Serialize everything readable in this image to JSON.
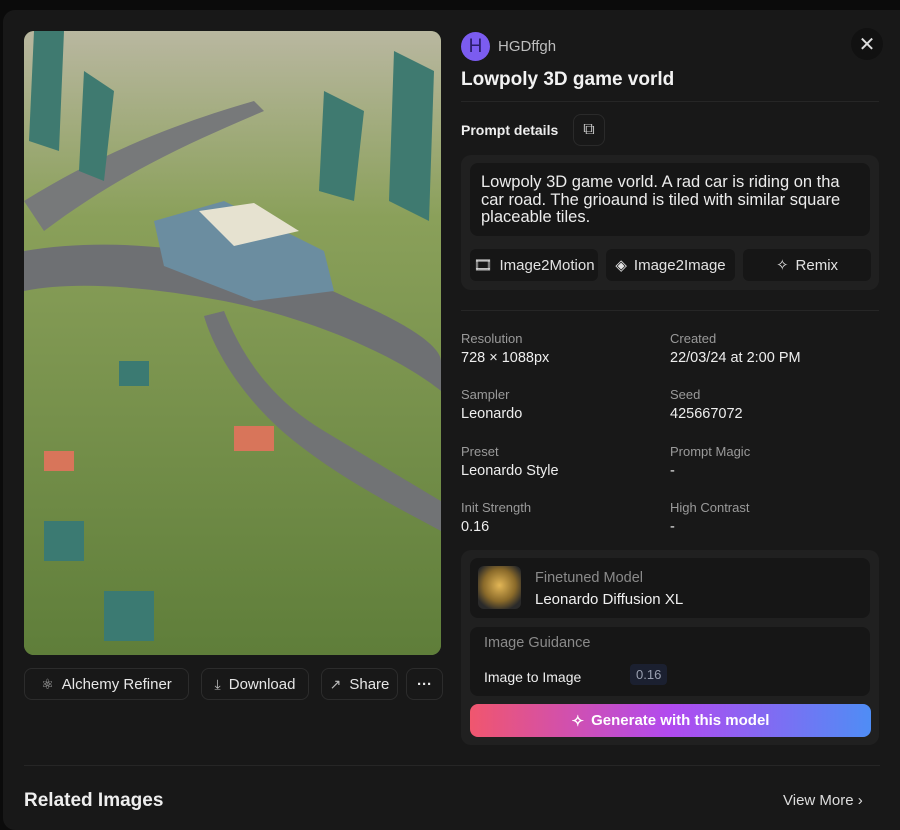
{
  "author": {
    "initial": "H",
    "name": "HGDffgh",
    "avatar_color": "#7b5cf0"
  },
  "title": "Lowpoly 3D game vorld",
  "prompt_section": {
    "label": "Prompt details",
    "text": "Lowpoly 3D game vorld. A rad car is riding on tha car road. The grioaund is tiled with similar square placeable tiles.",
    "buttons": [
      "Image2Motion",
      "Image2Image",
      "Remix"
    ]
  },
  "image_actions": {
    "alchemy": "Alchemy Refiner",
    "download": "Download",
    "share": "Share",
    "more": "···"
  },
  "meta": [
    {
      "label": "Resolution",
      "value": "728 × 1088px"
    },
    {
      "label": "Created",
      "value": "22/03/24 at 2:00 PM"
    },
    {
      "label": "Sampler",
      "value": "Leonardo"
    },
    {
      "label": "Seed",
      "value": "425667072"
    },
    {
      "label": "Preset",
      "value": "Leonardo Style"
    },
    {
      "label": "Prompt Magic",
      "value": "-"
    },
    {
      "label": "Init Strength",
      "value": "0.16"
    },
    {
      "label": "High Contrast",
      "value": "-"
    }
  ],
  "model": {
    "label": "Finetuned Model",
    "name": "Leonardo Diffusion XL"
  },
  "guidance": {
    "label": "Image Guidance",
    "item": "Image to Image",
    "value": "0.16"
  },
  "generate_label": "Generate with this model",
  "related": {
    "title": "Related Images",
    "view_more": "View More"
  }
}
